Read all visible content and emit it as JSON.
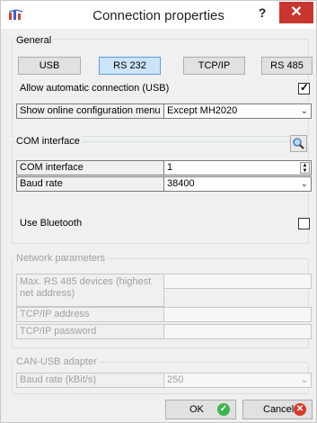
{
  "window": {
    "title": "Connection properties",
    "help_label": "?",
    "close_label": "✕"
  },
  "general": {
    "title": "General",
    "buttons": [
      "USB",
      "RS 232",
      "TCP/IP",
      "RS 485"
    ],
    "selected": "RS 232",
    "auto_connect_label": "Allow automatic connection (USB)",
    "auto_connect_checked": true,
    "online_menu_label": "Show online configuration menu",
    "online_menu_value": "Except MH2020"
  },
  "com": {
    "title": "COM interface",
    "interface_label": "COM interface",
    "interface_value": "1",
    "baud_label": "Baud rate",
    "baud_value": "38400",
    "bluetooth_label": "Use Bluetooth",
    "bluetooth_checked": false
  },
  "network": {
    "title": "Network parameters",
    "max_devices_label": "Max. RS 485 devices (highest net address)",
    "max_devices_value": "",
    "tcp_address_label": "TCP/IP address",
    "tcp_address_value": "",
    "tcp_password_label": "TCP/IP password",
    "tcp_password_value": ""
  },
  "can": {
    "title": "CAN-USB adapter",
    "baud_label": "Baud rate (kBit/s)",
    "baud_value": "250"
  },
  "footer": {
    "ok_label": "OK",
    "cancel_label": "Cancel"
  }
}
